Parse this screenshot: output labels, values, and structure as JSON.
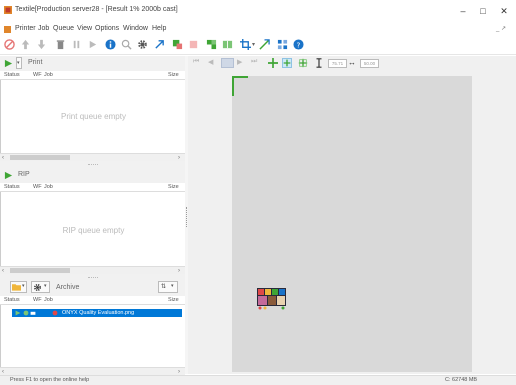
{
  "window": {
    "title": "Textile[Production server28 - [Result 1% 2000b cast]",
    "minimize_glyph": "–",
    "maximize_glyph": "□",
    "close_glyph": "✕"
  },
  "menu": {
    "items": [
      "Printer",
      "Job",
      "Queue",
      "View",
      "Options",
      "Window",
      "Help"
    ],
    "mdi_controls": "_ ↗"
  },
  "print_section": {
    "label": "Print",
    "columns": [
      "Status",
      "WF",
      "Job",
      "Size"
    ],
    "empty_message": "Print queue empty"
  },
  "rip_section": {
    "label": "RIP",
    "columns": [
      "Status",
      "WF",
      "Job",
      "Size"
    ],
    "empty_message": "RIP queue empty"
  },
  "archive_section": {
    "label": "Archive",
    "columns": [
      "Status",
      "WF",
      "Job",
      "Size"
    ],
    "jobs": [
      {
        "name": "ONYX Quality Evaluation.png"
      }
    ]
  },
  "status_bar": {
    "help_text": "Press F1 to open the online help",
    "memory": "C: 62748 MB"
  },
  "preview": {
    "zoom_left": "75.71",
    "zoom_right": "50.00"
  },
  "colors": {
    "accent_green": "#3fa535",
    "accent_blue": "#1a73c8",
    "selection": "#0078d7"
  }
}
